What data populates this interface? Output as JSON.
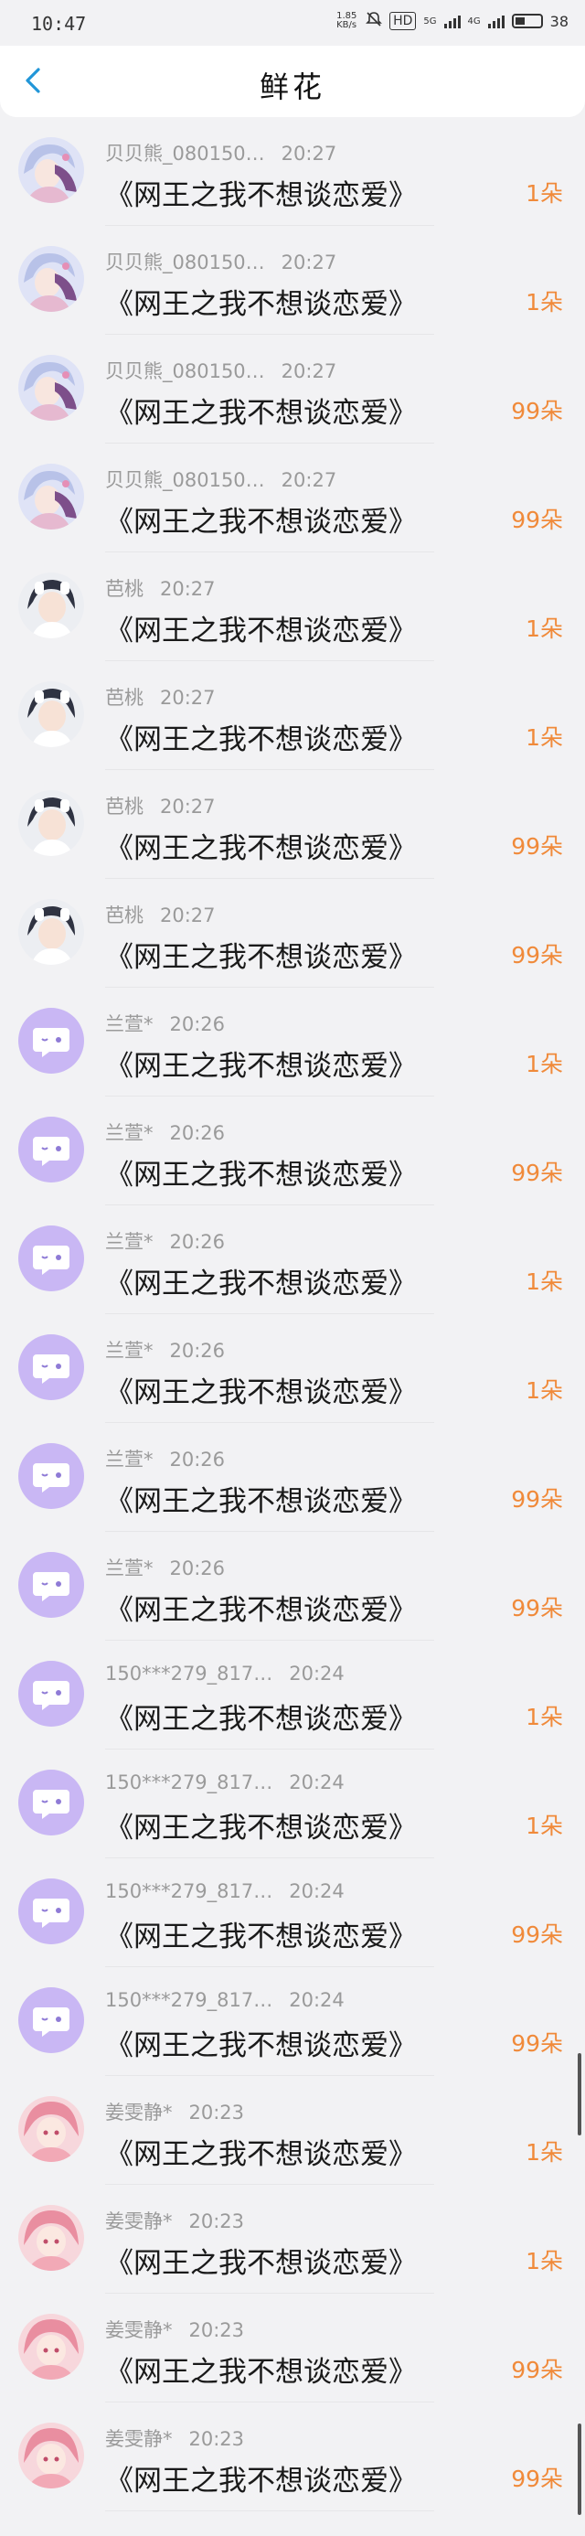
{
  "status_bar": {
    "time": "10:47",
    "speed": "1.85 KB/s",
    "hd_label": "HD",
    "net_label_1": "5G",
    "net_label_2": "4G",
    "battery": "38"
  },
  "header": {
    "title": "鲜花"
  },
  "avatar_colors": {
    "anime_blue": "#c9d3f0",
    "anime_dark": "#3a3f4f",
    "purple_default": "#c9b7f4",
    "pink": "#f3b6c3"
  },
  "accent_count_color": "#f08a3a",
  "list": [
    {
      "name": "贝贝熊_080150…",
      "time": "20:27",
      "title": "《网王之我不想谈恋爱》",
      "count": "1朵",
      "avatar": "anime-blue"
    },
    {
      "name": "贝贝熊_080150…",
      "time": "20:27",
      "title": "《网王之我不想谈恋爱》",
      "count": "1朵",
      "avatar": "anime-blue"
    },
    {
      "name": "贝贝熊_080150…",
      "time": "20:27",
      "title": "《网王之我不想谈恋爱》",
      "count": "99朵",
      "avatar": "anime-blue"
    },
    {
      "name": "贝贝熊_080150…",
      "time": "20:27",
      "title": "《网王之我不想谈恋爱》",
      "count": "99朵",
      "avatar": "anime-blue"
    },
    {
      "name": "芭桃",
      "time": "20:27",
      "title": "《网王之我不想谈恋爱》",
      "count": "1朵",
      "avatar": "anime-dark"
    },
    {
      "name": "芭桃",
      "time": "20:27",
      "title": "《网王之我不想谈恋爱》",
      "count": "1朵",
      "avatar": "anime-dark"
    },
    {
      "name": "芭桃",
      "time": "20:27",
      "title": "《网王之我不想谈恋爱》",
      "count": "99朵",
      "avatar": "anime-dark"
    },
    {
      "name": "芭桃",
      "time": "20:27",
      "title": "《网王之我不想谈恋爱》",
      "count": "99朵",
      "avatar": "anime-dark"
    },
    {
      "name": "兰萱*",
      "time": "20:26",
      "title": "《网王之我不想谈恋爱》",
      "count": "1朵",
      "avatar": "purple"
    },
    {
      "name": "兰萱*",
      "time": "20:26",
      "title": "《网王之我不想谈恋爱》",
      "count": "99朵",
      "avatar": "purple"
    },
    {
      "name": "兰萱*",
      "time": "20:26",
      "title": "《网王之我不想谈恋爱》",
      "count": "1朵",
      "avatar": "purple"
    },
    {
      "name": "兰萱*",
      "time": "20:26",
      "title": "《网王之我不想谈恋爱》",
      "count": "1朵",
      "avatar": "purple"
    },
    {
      "name": "兰萱*",
      "time": "20:26",
      "title": "《网王之我不想谈恋爱》",
      "count": "99朵",
      "avatar": "purple"
    },
    {
      "name": "兰萱*",
      "time": "20:26",
      "title": "《网王之我不想谈恋爱》",
      "count": "99朵",
      "avatar": "purple"
    },
    {
      "name": "150***279_817…",
      "time": "20:24",
      "title": "《网王之我不想谈恋爱》",
      "count": "1朵",
      "avatar": "purple"
    },
    {
      "name": "150***279_817…",
      "time": "20:24",
      "title": "《网王之我不想谈恋爱》",
      "count": "1朵",
      "avatar": "purple"
    },
    {
      "name": "150***279_817…",
      "time": "20:24",
      "title": "《网王之我不想谈恋爱》",
      "count": "99朵",
      "avatar": "purple"
    },
    {
      "name": "150***279_817…",
      "time": "20:24",
      "title": "《网王之我不想谈恋爱》",
      "count": "99朵",
      "avatar": "purple"
    },
    {
      "name": "姜雯静*",
      "time": "20:23",
      "title": "《网王之我不想谈恋爱》",
      "count": "1朵",
      "avatar": "pink"
    },
    {
      "name": "姜雯静*",
      "time": "20:23",
      "title": "《网王之我不想谈恋爱》",
      "count": "1朵",
      "avatar": "pink"
    },
    {
      "name": "姜雯静*",
      "time": "20:23",
      "title": "《网王之我不想谈恋爱》",
      "count": "99朵",
      "avatar": "pink"
    },
    {
      "name": "姜雯静*",
      "time": "20:23",
      "title": "《网王之我不想谈恋爱》",
      "count": "99朵",
      "avatar": "pink"
    }
  ]
}
